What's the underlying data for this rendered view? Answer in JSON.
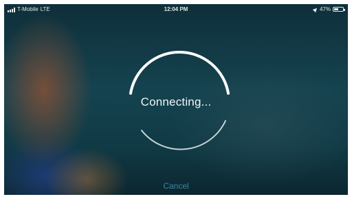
{
  "status_bar": {
    "carrier": "T-Mobile",
    "network": "LTE",
    "time": "12:04 PM",
    "battery_percent_label": "47%",
    "battery_level": 0.47,
    "signal_bars": 4
  },
  "call": {
    "status_text": "Connecting...",
    "cancel_label": "Cancel"
  },
  "icons": {
    "signal": "signal-bars-icon",
    "location": "location-arrow-icon",
    "battery": "battery-icon",
    "spinner": "connecting-spinner-icon"
  }
}
